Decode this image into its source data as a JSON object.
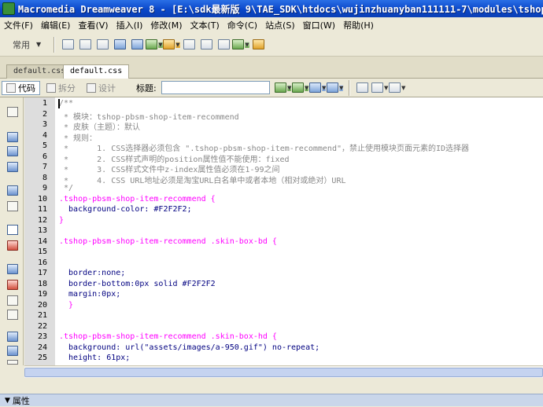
{
  "window": {
    "title": "Macromedia Dreamweaver 8 - [E:\\sdk最新版 9\\TAE_SDK\\htdocs\\wujinzhuanyban111111-7\\modules\\tshop",
    "icon": "dreamweaver-logo-icon"
  },
  "menu": [
    {
      "label": "文件(F)"
    },
    {
      "label": "编辑(E)"
    },
    {
      "label": "查看(V)"
    },
    {
      "label": "插入(I)"
    },
    {
      "label": "修改(M)"
    },
    {
      "label": "文本(T)"
    },
    {
      "label": "命令(C)"
    },
    {
      "label": "站点(S)"
    },
    {
      "label": "窗口(W)"
    },
    {
      "label": "帮助(H)"
    }
  ],
  "insert_bar": {
    "category": "常用"
  },
  "document_tabs": [
    {
      "label": "default.css",
      "active": false
    },
    {
      "label": "default.css",
      "active": true
    }
  ],
  "doc_toolbar": {
    "code_label": "代码",
    "split_label": "拆分",
    "design_label": "设计",
    "title_label": "标题:",
    "title_value": ""
  },
  "editor": {
    "line_numbers": [
      "1",
      "2",
      "3",
      "4",
      "5",
      "6",
      "7",
      "8",
      "9",
      "10",
      "11",
      "12",
      "13",
      "14",
      "15",
      "16",
      "17",
      "18",
      "19",
      "20",
      "21",
      "22",
      "23",
      "24",
      "25"
    ],
    "lines": [
      {
        "text": "/**",
        "kind": "comment"
      },
      {
        "text": " * 模块：tshop-pbsm-shop-item-recommend",
        "kind": "comment"
      },
      {
        "text": " * 皮肤（主题）：默认",
        "kind": "comment"
      },
      {
        "text": " * 规则：",
        "kind": "comment"
      },
      {
        "text": " *      1. CSS选择器必须包含 \".tshop-pbsm-shop-item-recommend\"，禁止使用模块页面元素的ID选择器",
        "kind": "comment"
      },
      {
        "text": " *      2. CSS样式声明的position属性值不能使用：fixed",
        "kind": "comment"
      },
      {
        "text": " *      3. CSS样式文件中z-index属性值必须在1-99之间",
        "kind": "comment"
      },
      {
        "text": " *      4. CSS URL地址必须是淘宝URL白名单中或者本地（相对或绝对）URL",
        "kind": "comment"
      },
      {
        "text": " */",
        "kind": "comment"
      },
      {
        "text": ".tshop-pbsm-shop-item-recommend {",
        "kind": "selector"
      },
      {
        "text": "  background-color: #F2F2F2;",
        "kind": "prop"
      },
      {
        "text": "}",
        "kind": "brace"
      },
      {
        "text": "",
        "kind": "blank"
      },
      {
        "text": ".tshop-pbsm-shop-item-recommend .skin-box-bd {",
        "kind": "selector"
      },
      {
        "text": "",
        "kind": "blank"
      },
      {
        "text": "",
        "kind": "blank"
      },
      {
        "text": "  border:none;",
        "kind": "prop"
      },
      {
        "text": "  border-bottom:0px solid #F2F2F2",
        "kind": "prop"
      },
      {
        "text": "  margin:0px;",
        "kind": "prop"
      },
      {
        "text": "  }",
        "kind": "brace"
      },
      {
        "text": "",
        "kind": "blank"
      },
      {
        "text": "",
        "kind": "blank"
      },
      {
        "text": ".tshop-pbsm-shop-item-recommend .skin-box-hd {",
        "kind": "selector"
      },
      {
        "text": "  background: url(\"assets/images/a-950.gif\") no-repeat;",
        "kind": "prop"
      },
      {
        "text": "  height: 61px;",
        "kind": "prop"
      }
    ]
  },
  "properties_panel": {
    "label": "属性"
  },
  "colors": {
    "titlebar": "#0a47c9",
    "selector": "#ff00ff",
    "comment": "#888888",
    "property": "#000080"
  }
}
